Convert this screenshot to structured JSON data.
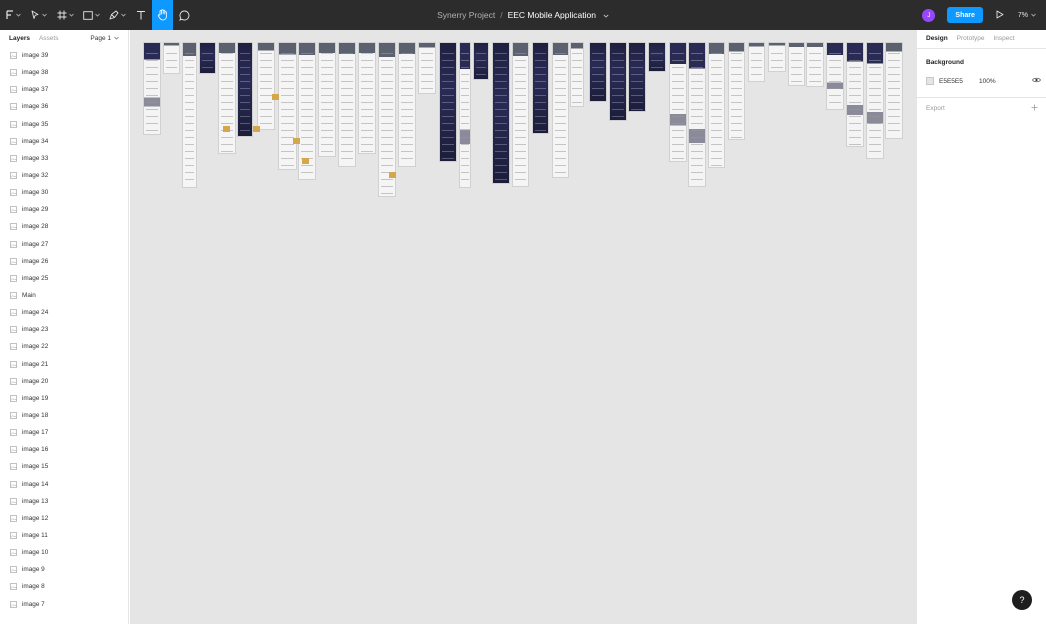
{
  "toolbar": {
    "tools": [
      {
        "name": "main-menu-button",
        "icon": "figma-logo-icon",
        "caret": true,
        "active": false
      },
      {
        "name": "move-tool-button",
        "icon": "move-arrow-icon",
        "caret": true,
        "active": false
      },
      {
        "name": "frame-tool-button",
        "icon": "frame-hash-icon",
        "caret": true,
        "active": false
      },
      {
        "name": "shape-tool-button",
        "icon": "rectangle-icon",
        "caret": true,
        "active": false
      },
      {
        "name": "pen-tool-button",
        "icon": "pen-icon",
        "caret": true,
        "active": false
      },
      {
        "name": "text-tool-button",
        "icon": "text-icon",
        "caret": false,
        "active": false
      },
      {
        "name": "hand-tool-button",
        "icon": "hand-icon",
        "caret": false,
        "active": true
      },
      {
        "name": "comment-tool-button",
        "icon": "comment-icon",
        "caret": false,
        "active": false
      }
    ]
  },
  "file": {
    "project": "Synerry Project",
    "separator": "/",
    "name": "EEC Mobile Application"
  },
  "user": {
    "avatar_initial": "J"
  },
  "share_label": "Share",
  "zoom": "7%",
  "left_panel": {
    "tabs": [
      "Layers",
      "Assets"
    ],
    "page": "Page 1",
    "layers": [
      "image 39",
      "image 38",
      "image 37",
      "image 36",
      "image 35",
      "image 34",
      "image 33",
      "image 32",
      "image 30",
      "image 29",
      "image 28",
      "image 27",
      "image 26",
      "image 25",
      "Main",
      "image 24",
      "image 23",
      "image 22",
      "image 21",
      "image 20",
      "image 19",
      "image 18",
      "image 17",
      "image 16",
      "image 15",
      "image 14",
      "image 13",
      "image 12",
      "image 11",
      "image 10",
      "image 9",
      "image 8",
      "image 7"
    ]
  },
  "right_panel": {
    "tabs": [
      "Design",
      "Prototype",
      "Inspect"
    ],
    "background_title": "Background",
    "background_hex": "E5E5E5",
    "background_opacity": "100%",
    "export_title": "Export"
  },
  "help_label": "?",
  "colors": {
    "topbar": "#2c2c2c",
    "accent": "#0d99ff",
    "avatar": "#9747ff",
    "canvas": "#e5e5e5"
  }
}
